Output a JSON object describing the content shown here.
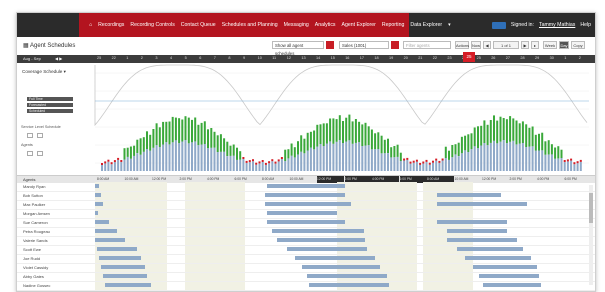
{
  "nav": {
    "items": [
      "Recordings",
      "Recording Controls",
      "Contact Queue",
      "Schedules and Planning",
      "Messaging",
      "Analytics",
      "Agent Explorer",
      "Reporting",
      "Data Explorer"
    ],
    "signed_in_prefix": "Signed in:",
    "user": "Tammy Mathias",
    "help": "Help"
  },
  "toolbar": {
    "title": "Agent Schedules",
    "select1": "Show all agent schedules",
    "select2": "Sales (1001)",
    "select3": "Filter agents",
    "buttons": [
      "Actions",
      "Now",
      "1 of 1",
      "Week",
      "Day",
      "Copy"
    ]
  },
  "timebar": {
    "label": "Aug - Sep",
    "ticks": [
      "25",
      "22",
      "1",
      "2",
      "3",
      "4",
      "5",
      "6",
      "7",
      "8",
      "9",
      "10",
      "11",
      "12",
      "13",
      "14",
      "15",
      "16",
      "17",
      "18",
      "19",
      "20",
      "21",
      "22",
      "23",
      "24",
      "25",
      "26",
      "27",
      "28",
      "29",
      "30",
      "1",
      "2"
    ],
    "selected": "25"
  },
  "left_panel": {
    "coverage_label": "Coverage Schedule",
    "pills": [
      "Full Time",
      "Forecasted",
      "Scheduled"
    ],
    "service_level": "Service Level Schedule",
    "agents": "Agents"
  },
  "columns": {
    "agents_header": "Agents",
    "day_headers": [
      "8:00 AM",
      "10:00 AM",
      "12:00 PM",
      "2:00 PM",
      "4:00 PM",
      "6:00 PM",
      "8:00 AM",
      "10:00 AM",
      "12:00 PM",
      "2:00 PM",
      "4:00 PM",
      "6:00 PM",
      "8:00 AM",
      "10:00 AM",
      "12:00 PM",
      "2:00 PM",
      "4:00 PM",
      "6:00 PM"
    ]
  },
  "agents": [
    "Mandy Ryan",
    "Bob Sutton",
    "Max Paulker",
    "Morgan Amsen",
    "Sue Cameron",
    "Petra Rougeau",
    "Valerie Sands",
    "Scott Ewe",
    "Joe Rudd",
    "Violet Cassidy",
    "Abby Gates",
    "Nadine Gossec"
  ],
  "colors": {
    "nav_red": "#b3141f",
    "dark": "#2b2b2b",
    "bar_blue": "#8fa9c8",
    "bar_green": "#3aa83a"
  }
}
